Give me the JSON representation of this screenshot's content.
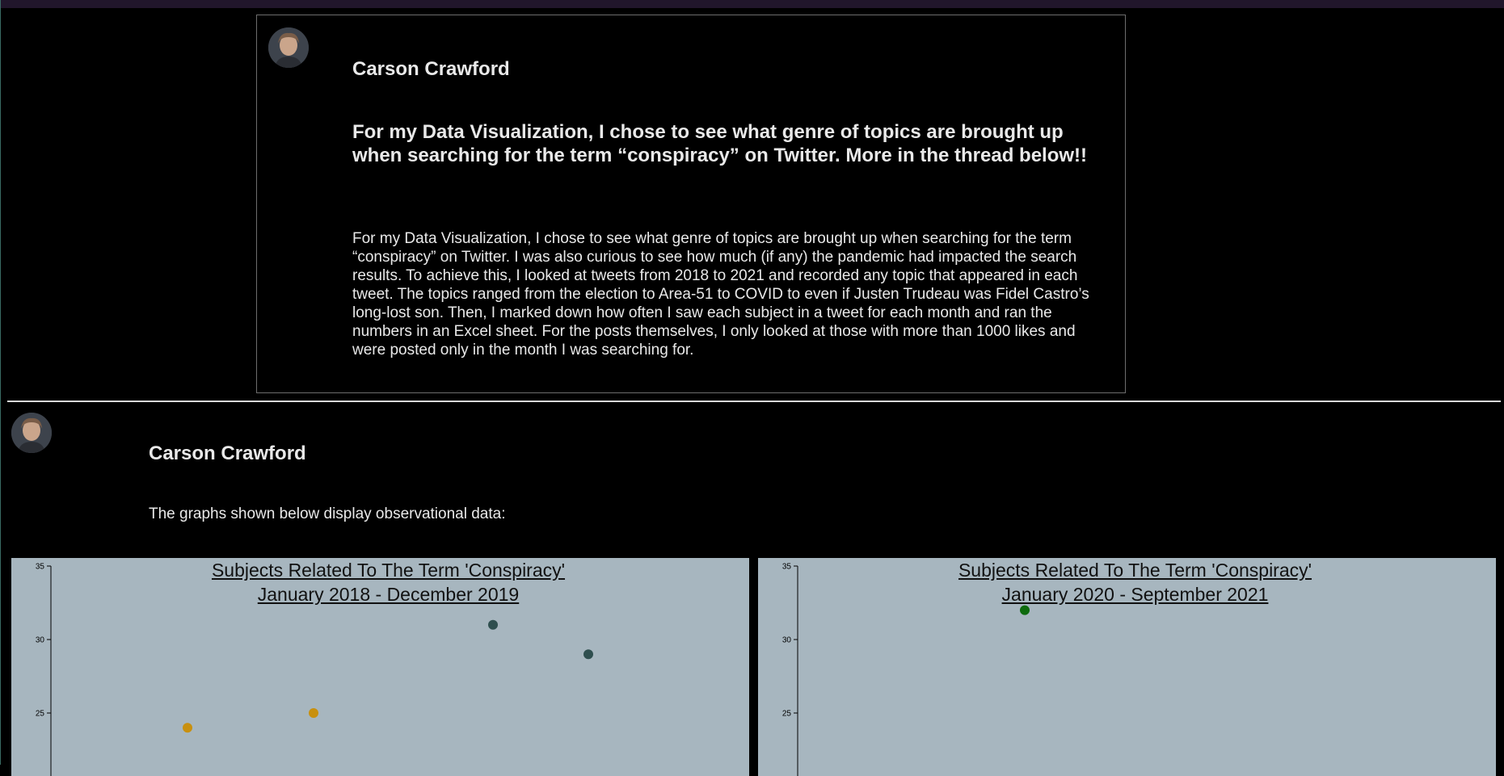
{
  "post1": {
    "author": "Carson Crawford",
    "headline": "For my Data Visualization, I chose to see what genre of topics are brought up when searching for the term “conspiracy” on Twitter. More in the thread below!!",
    "body": "For my Data Visualization, I chose to see what genre of topics are brought up when searching for the term “conspiracy” on Twitter. I was also curious to see how much (if any) the pandemic had impacted the search results. To achieve this, I looked at tweets from 2018 to 2021 and recorded any topic that appeared in each tweet. The topics ranged from the election to Area-51 to COVID to even if Justen Trudeau was Fidel Castro’s long-lost son. Then, I marked down how often I saw each subject in a tweet for each month and ran the numbers in an Excel sheet. For the posts themselves, I only looked at those with more than 1000 likes and were posted only in the month I was searching for."
  },
  "post2": {
    "author": "Carson Crawford",
    "text": "The graphs shown below display observational data:"
  },
  "chart_data": [
    {
      "type": "scatter",
      "title_line1": "Subjects Related To The Term 'Conspiracy'",
      "title_line2": "January 2018 - December 2019",
      "ylim": [
        22,
        35
      ],
      "yticks": [
        25,
        30,
        35
      ],
      "points": [
        {
          "y": 24,
          "color": "#c8900f"
        },
        {
          "y": 25,
          "color": "#c8900f"
        },
        {
          "y": 31,
          "color": "#2f4f4f"
        },
        {
          "y": 29,
          "color": "#2f4f4f"
        }
      ]
    },
    {
      "type": "scatter",
      "title_line1": "Subjects Related To The Term 'Conspiracy'",
      "title_line2": "January 2020 - September 2021",
      "ylim": [
        22,
        35
      ],
      "yticks": [
        25,
        30,
        35
      ],
      "points": [
        {
          "y": 32,
          "color": "#0e6b0e"
        }
      ]
    }
  ]
}
